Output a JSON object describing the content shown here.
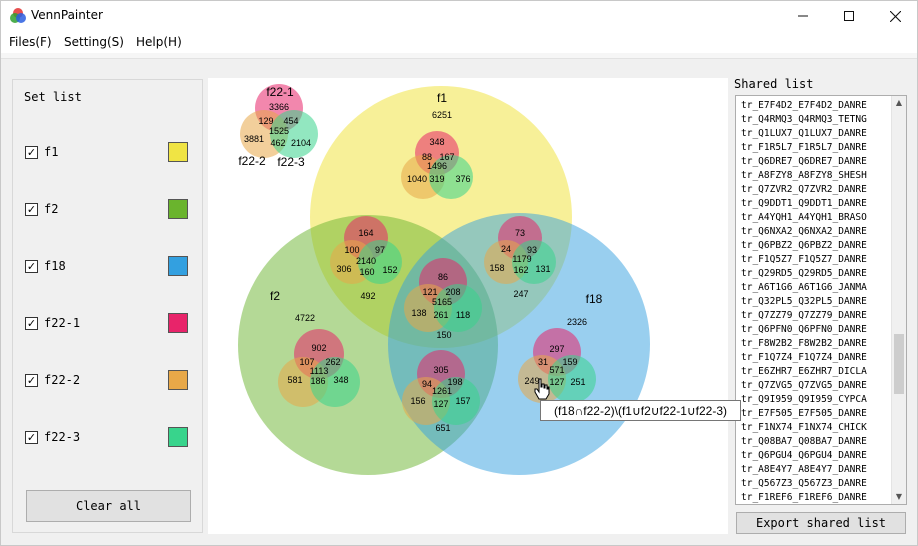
{
  "app": {
    "title": "VennPainter"
  },
  "menu": {
    "files": "Files(F)",
    "setting": "Setting(S)",
    "help": "Help(H)"
  },
  "set_list": {
    "title": "Set list",
    "items": [
      {
        "name": "f1",
        "checked": true,
        "color": "#f0e444"
      },
      {
        "name": "f2",
        "checked": true,
        "color": "#6ab42d"
      },
      {
        "name": "f18",
        "checked": true,
        "color": "#33a0e0"
      },
      {
        "name": "f22-1",
        "checked": true,
        "color": "#e8246a"
      },
      {
        "name": "f22-2",
        "checked": true,
        "color": "#e8a848"
      },
      {
        "name": "f22-3",
        "checked": true,
        "color": "#38d48c"
      }
    ],
    "clear_label": "Clear all"
  },
  "venn": {
    "big": {
      "f1": {
        "label": "f1",
        "count": "6251"
      },
      "f2": {
        "label": "f2",
        "count": "4722"
      },
      "f18": {
        "label": "f18",
        "count": "2326"
      },
      "f1_f2_n": "492",
      "f1_f18_n": "247",
      "f2_f18_n": "651",
      "all_n": "150"
    },
    "legend_group": {
      "label_a": "f22-1",
      "label_b": "f22-2",
      "label_c": "f22-3",
      "a": "3366",
      "ab": "129",
      "ac": "454",
      "abc": "1525",
      "b": "3881",
      "bc": "462",
      "c": "2104"
    },
    "groups": [
      {
        "a": "348",
        "ab": "88",
        "ac": "167",
        "abc": "1496",
        "b": "1040",
        "bc": "319",
        "c": "376"
      },
      {
        "a": "164",
        "ab": "100",
        "ac": "97",
        "abc": "2140",
        "b": "306",
        "bc": "160",
        "c": "152"
      },
      {
        "a": "73",
        "ab": "24",
        "ac": "93",
        "abc": "1179",
        "b": "158",
        "bc": "162",
        "c": "131"
      },
      {
        "a": "86",
        "ab": "121",
        "ac": "208",
        "abc": "5165",
        "b": "138",
        "bc": "261",
        "c": "118"
      },
      {
        "a": "902",
        "ab": "107",
        "ac": "262",
        "abc": "1113",
        "b": "581",
        "bc": "186",
        "c": "348"
      },
      {
        "a": "297",
        "ab": "31",
        "ac": "159",
        "abc": "571",
        "b": "249",
        "bc": "127",
        "c": "251"
      },
      {
        "a": "305",
        "ab": "94",
        "ac": "198",
        "abc": "1261",
        "b": "156",
        "bc": "127",
        "c": "157"
      }
    ]
  },
  "tooltip": "(f18∩f22-2)\\(f1∪f2∪f22-1∪f22-3)",
  "shared_list": {
    "title": "Shared list",
    "items": [
      "tr_E7F4D2_E7F4D2_DANRE",
      "tr_Q4RMQ3_Q4RMQ3_TETNG",
      "tr_Q1LUX7_Q1LUX7_DANRE",
      "tr_F1R5L7_F1R5L7_DANRE",
      "tr_Q6DRE7_Q6DRE7_DANRE",
      "tr_A8FZY8_A8FZY8_SHESH",
      "tr_Q7ZVR2_Q7ZVR2_DANRE",
      "tr_Q9DDT1_Q9DDT1_DANRE",
      "tr_A4YQH1_A4YQH1_BRASO",
      "tr_Q6NXA2_Q6NXA2_DANRE",
      "tr_Q6PBZ2_Q6PBZ2_DANRE",
      "tr_F1Q5Z7_F1Q5Z7_DANRE",
      "tr_Q29RD5_Q29RD5_DANRE",
      "tr_A6T1G6_A6T1G6_JANMA",
      "tr_Q32PL5_Q32PL5_DANRE",
      "tr_Q7ZZ79_Q7ZZ79_DANRE",
      "tr_Q6PFN0_Q6PFN0_DANRE",
      "tr_F8W2B2_F8W2B2_DANRE",
      "tr_F1Q7Z4_F1Q7Z4_DANRE",
      "tr_E6ZHR7_E6ZHR7_DICLA",
      "tr_Q7ZVG5_Q7ZVG5_DANRE",
      "tr_Q9I959_Q9I959_CYPCA",
      "tr_E7F505_E7F505_DANRE",
      "tr_F1NX74_F1NX74_CHICK",
      "tr_Q08BA7_Q08BA7_DANRE",
      "tr_Q6PGU4_Q6PGU4_DANRE",
      "tr_A8E4Y7_A8E4Y7_DANRE",
      "tr_Q567Z3_Q567Z3_DANRE",
      "tr_F1REF6_F1REF6_DANRE"
    ],
    "export_label": "Export shared list"
  }
}
